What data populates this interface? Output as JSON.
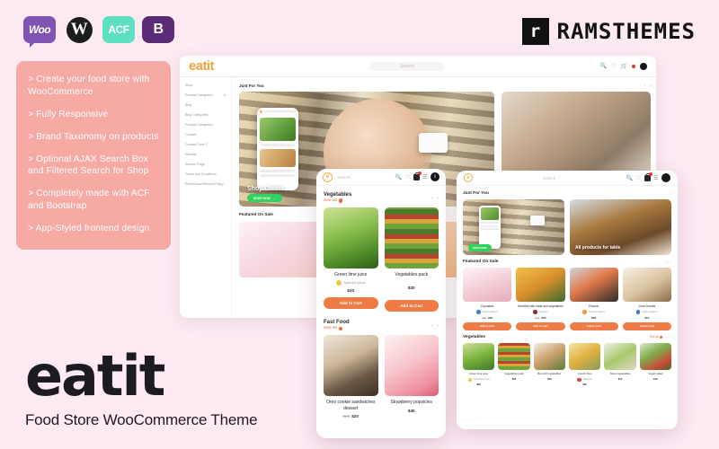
{
  "logos": [
    {
      "name": "woocommerce-logo",
      "label": "Woo"
    },
    {
      "name": "wordpress-logo",
      "label": "W"
    },
    {
      "name": "acf-logo",
      "label": "ACF"
    },
    {
      "name": "bootstrap-logo",
      "label": "B"
    }
  ],
  "vendor": {
    "mark": "r",
    "name": "RAMSTHEMES"
  },
  "features": [
    "> Create your food store with WooCommerce",
    "> Fully Responsive",
    "> Brand Taxonomy on products",
    "> Optional AJAX Search Box and Filtered Search for Shop",
    "> Completely made with ACF and  Bootstrap",
    "> App-Styled frontend design"
  ],
  "brand": {
    "name": "eatit",
    "tagline": "Food Store WooCommerce Theme"
  },
  "colors": {
    "page_bg": "#fdeaf3",
    "feature_box": "#f7a9a4",
    "accent_orange": "#ef7b47",
    "logo_orange": "#f0a63c",
    "cta_green": "#2fd35e",
    "badge_red": "#e8372b"
  },
  "desktop": {
    "logo": "eatit",
    "search_placeholder": "Search",
    "menu": [
      {
        "label": "Shop",
        "caret": ""
      },
      {
        "label": "Product Categories",
        "caret": "▾"
      },
      {
        "label": "Blog",
        "caret": ""
      },
      {
        "label": "Blog Categories",
        "caret": ""
      },
      {
        "label": "Product Categories",
        "caret": ""
      },
      {
        "label": "Contact",
        "caret": ""
      },
      {
        "label": "Contact Form 7",
        "caret": ""
      },
      {
        "label": "Wishlist",
        "caret": ""
      },
      {
        "label": "Sample Page",
        "caret": ""
      },
      {
        "label": "Terms and Conditions",
        "caret": ""
      },
      {
        "label": "Refund and Returns Policy",
        "caret": ""
      }
    ],
    "section_just_for_you": "Just For You",
    "hero_title": "Shop Online",
    "hero_cta": "SHOP NOW",
    "section_featured": "Featured On Sale",
    "prev": "‹",
    "next": "›"
  },
  "phone": {
    "logo": "e",
    "search_placeholder": "Search",
    "cart_count": "1",
    "avatar": "i",
    "sections": [
      {
        "title": "Vegetables",
        "see_all": "See all",
        "products": [
          {
            "name": "Green lime juice",
            "brand": "Splendor juices",
            "price": "$20"
          },
          {
            "name": "Vegetables pack",
            "brand": "",
            "price": "$20"
          }
        ],
        "cta": "Add to Cart"
      },
      {
        "title": "Fast Food",
        "see_all": "See all",
        "products": [
          {
            "name": "Oreo cookie sandwiches dessert",
            "old_price": "$25",
            "price": "$20"
          },
          {
            "name": "Strawberry popsicles",
            "price": "$40"
          }
        ]
      }
    ],
    "prev": "‹",
    "next": "›"
  },
  "tablet": {
    "logo": "e",
    "search_placeholder": "Search",
    "section_just_for_you": "Just For You",
    "hero_cta": "SHOP NOW",
    "hero_title": "All products for table",
    "section_featured": "Featured On Sale",
    "featured": [
      {
        "name": "Cupcakes",
        "brand": "DigDug Bakery",
        "old_price": "$50",
        "price": "$40",
        "cta": "Add to Cart"
      },
      {
        "name": "Noodles with meat and vegetables",
        "brand": "Dietpoint",
        "old_price": "$45",
        "price": "$30",
        "cta": "Add to Cart"
      },
      {
        "name": "Prawns",
        "brand": "Gourmet Farms",
        "price": "$28",
        "cta": "Add to Cart"
      },
      {
        "name": "Lima Donuts",
        "brand": "DigDug Bakery",
        "price": "$14",
        "cta": "Add to Cart"
      }
    ],
    "vegetables_title": "Vegetables",
    "see_all": "See all",
    "vegetables": [
      {
        "name": "Green lime juice",
        "brand": "Splendor juices",
        "price": "$20"
      },
      {
        "name": "Vegetables pack",
        "price": "$20"
      },
      {
        "name": "Bun with vegetables",
        "price": "$20"
      },
      {
        "name": "French fries",
        "brand": "Vitapoint",
        "price": "$20"
      },
      {
        "name": "Sliced vegetables",
        "price": "$15"
      },
      {
        "name": "Vegan salad",
        "price": "$18"
      }
    ],
    "prev": "‹",
    "next": "›"
  }
}
